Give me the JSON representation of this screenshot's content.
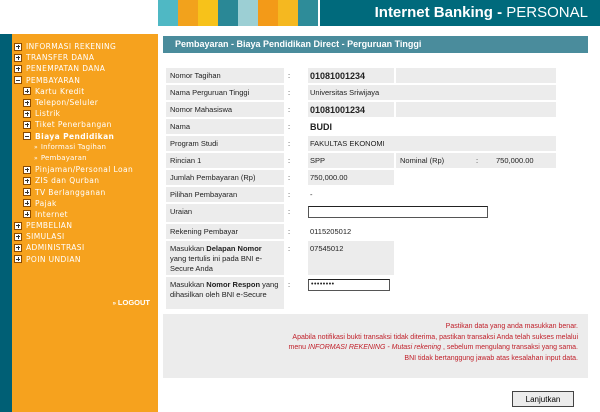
{
  "header": {
    "title_bold": "Internet Banking -",
    "title_light": " PERSONAL",
    "blocks": [
      "#4fb8c4",
      "#f2a21c",
      "#f7c21a",
      "#2a8896",
      "#9ccfd4",
      "#f39a18",
      "#f5b820",
      "#2e8c99"
    ]
  },
  "sidebar": {
    "items": [
      {
        "label": "INFORMASI REKENING",
        "level": 1,
        "box": "plus"
      },
      {
        "label": "TRANSFER DANA",
        "level": 1,
        "box": "plus"
      },
      {
        "label": "PENEMPATAN DANA",
        "level": 1,
        "box": "plus"
      },
      {
        "label": "PEMBAYARAN",
        "level": 1,
        "box": "minus"
      },
      {
        "label": "Kartu Kredit",
        "level": 2,
        "box": "plus"
      },
      {
        "label": "Telepon/Seluler",
        "level": 2,
        "box": "plus"
      },
      {
        "label": "Listrik",
        "level": 2,
        "box": "plus"
      },
      {
        "label": "Tiket Penerbangan",
        "level": 2,
        "box": "plus"
      },
      {
        "label": "Biaya Pendidikan",
        "level": 2,
        "box": "minus"
      },
      {
        "label": "Informasi Tagihan",
        "level": 3
      },
      {
        "label": "Pembayaran",
        "level": 3
      },
      {
        "label": "Pinjaman/Personal Loan",
        "level": 2,
        "box": "plus"
      },
      {
        "label": "ZIS dan Qurban",
        "level": 2,
        "box": "plus"
      },
      {
        "label": "TV Berlangganan",
        "level": 2,
        "box": "plus"
      },
      {
        "label": "Pajak",
        "level": 2,
        "box": "plus"
      },
      {
        "label": "Internet",
        "level": 2,
        "box": "plus"
      },
      {
        "label": "PEMBELIAN",
        "level": 1,
        "box": "plus"
      },
      {
        "label": "SIMULASI",
        "level": 1,
        "box": "plus"
      },
      {
        "label": "ADMINISTRASI",
        "level": 1,
        "box": "plus"
      },
      {
        "label": "POIN UNDIAN",
        "level": 1,
        "box": "plus"
      }
    ],
    "logout": "LOGOUT"
  },
  "main": {
    "section_title": "Pembayaran - Biaya Pendidikan Direct - Perguruan Tinggi",
    "rows": {
      "nomor_tagihan": {
        "label": "Nomor Tagihan",
        "value": "01081001234"
      },
      "nama_pt": {
        "label": "Nama Perguruan Tinggi",
        "value": "Universitas Sriwijaya"
      },
      "nomor_mhs": {
        "label": "Nomor Mahasiswa",
        "value": "01081001234"
      },
      "nama": {
        "label": "Nama",
        "value": "BUDI"
      },
      "prodi": {
        "label": "Program Studi",
        "value": "FAKULTAS EKONOMI"
      },
      "rincian": {
        "label": "Rincian 1",
        "value": "SPP",
        "nominal_label": "Nominal (Rp)",
        "nominal_value": "750,000.00"
      },
      "jumlah": {
        "label": "Jumlah Pembayaran (Rp)",
        "value": "750,000.00"
      },
      "pilihan": {
        "label": "Pilihan Pembayaran",
        "value": "-"
      },
      "uraian": {
        "label": "Uraian",
        "value": ""
      },
      "rekening": {
        "label": "Rekening Pembayar",
        "value": "0115205012"
      },
      "delapan": {
        "label_pre": "Masukkan ",
        "label_bold": "Delapan Nomor",
        "label_post": " yang tertulis ini pada BNI e-Secure Anda",
        "value": "07545012"
      },
      "respon": {
        "label_pre": "Masukkan ",
        "label_bold": "Nomor Respon",
        "label_post": " yang dihasilkan oleh BNI e-Secure",
        "value": "••••••••"
      }
    },
    "colon": ":",
    "notice": {
      "line1": "Pastikan data yang anda masukkan benar.",
      "line2": "Apabila notifikasi bukti transaksi tidak diterima, pastikan transaksi Anda telah sukses melalui",
      "line3_pre": "menu ",
      "line3_em": "INFORMASI REKENING - Mutasi rekening",
      "line3_post": " , sebelum mengulang transaksi yang sama.",
      "line4": "BNI tidak bertanggung jawab atas kesalahan input data."
    },
    "button_label": "Lanjutkan"
  }
}
